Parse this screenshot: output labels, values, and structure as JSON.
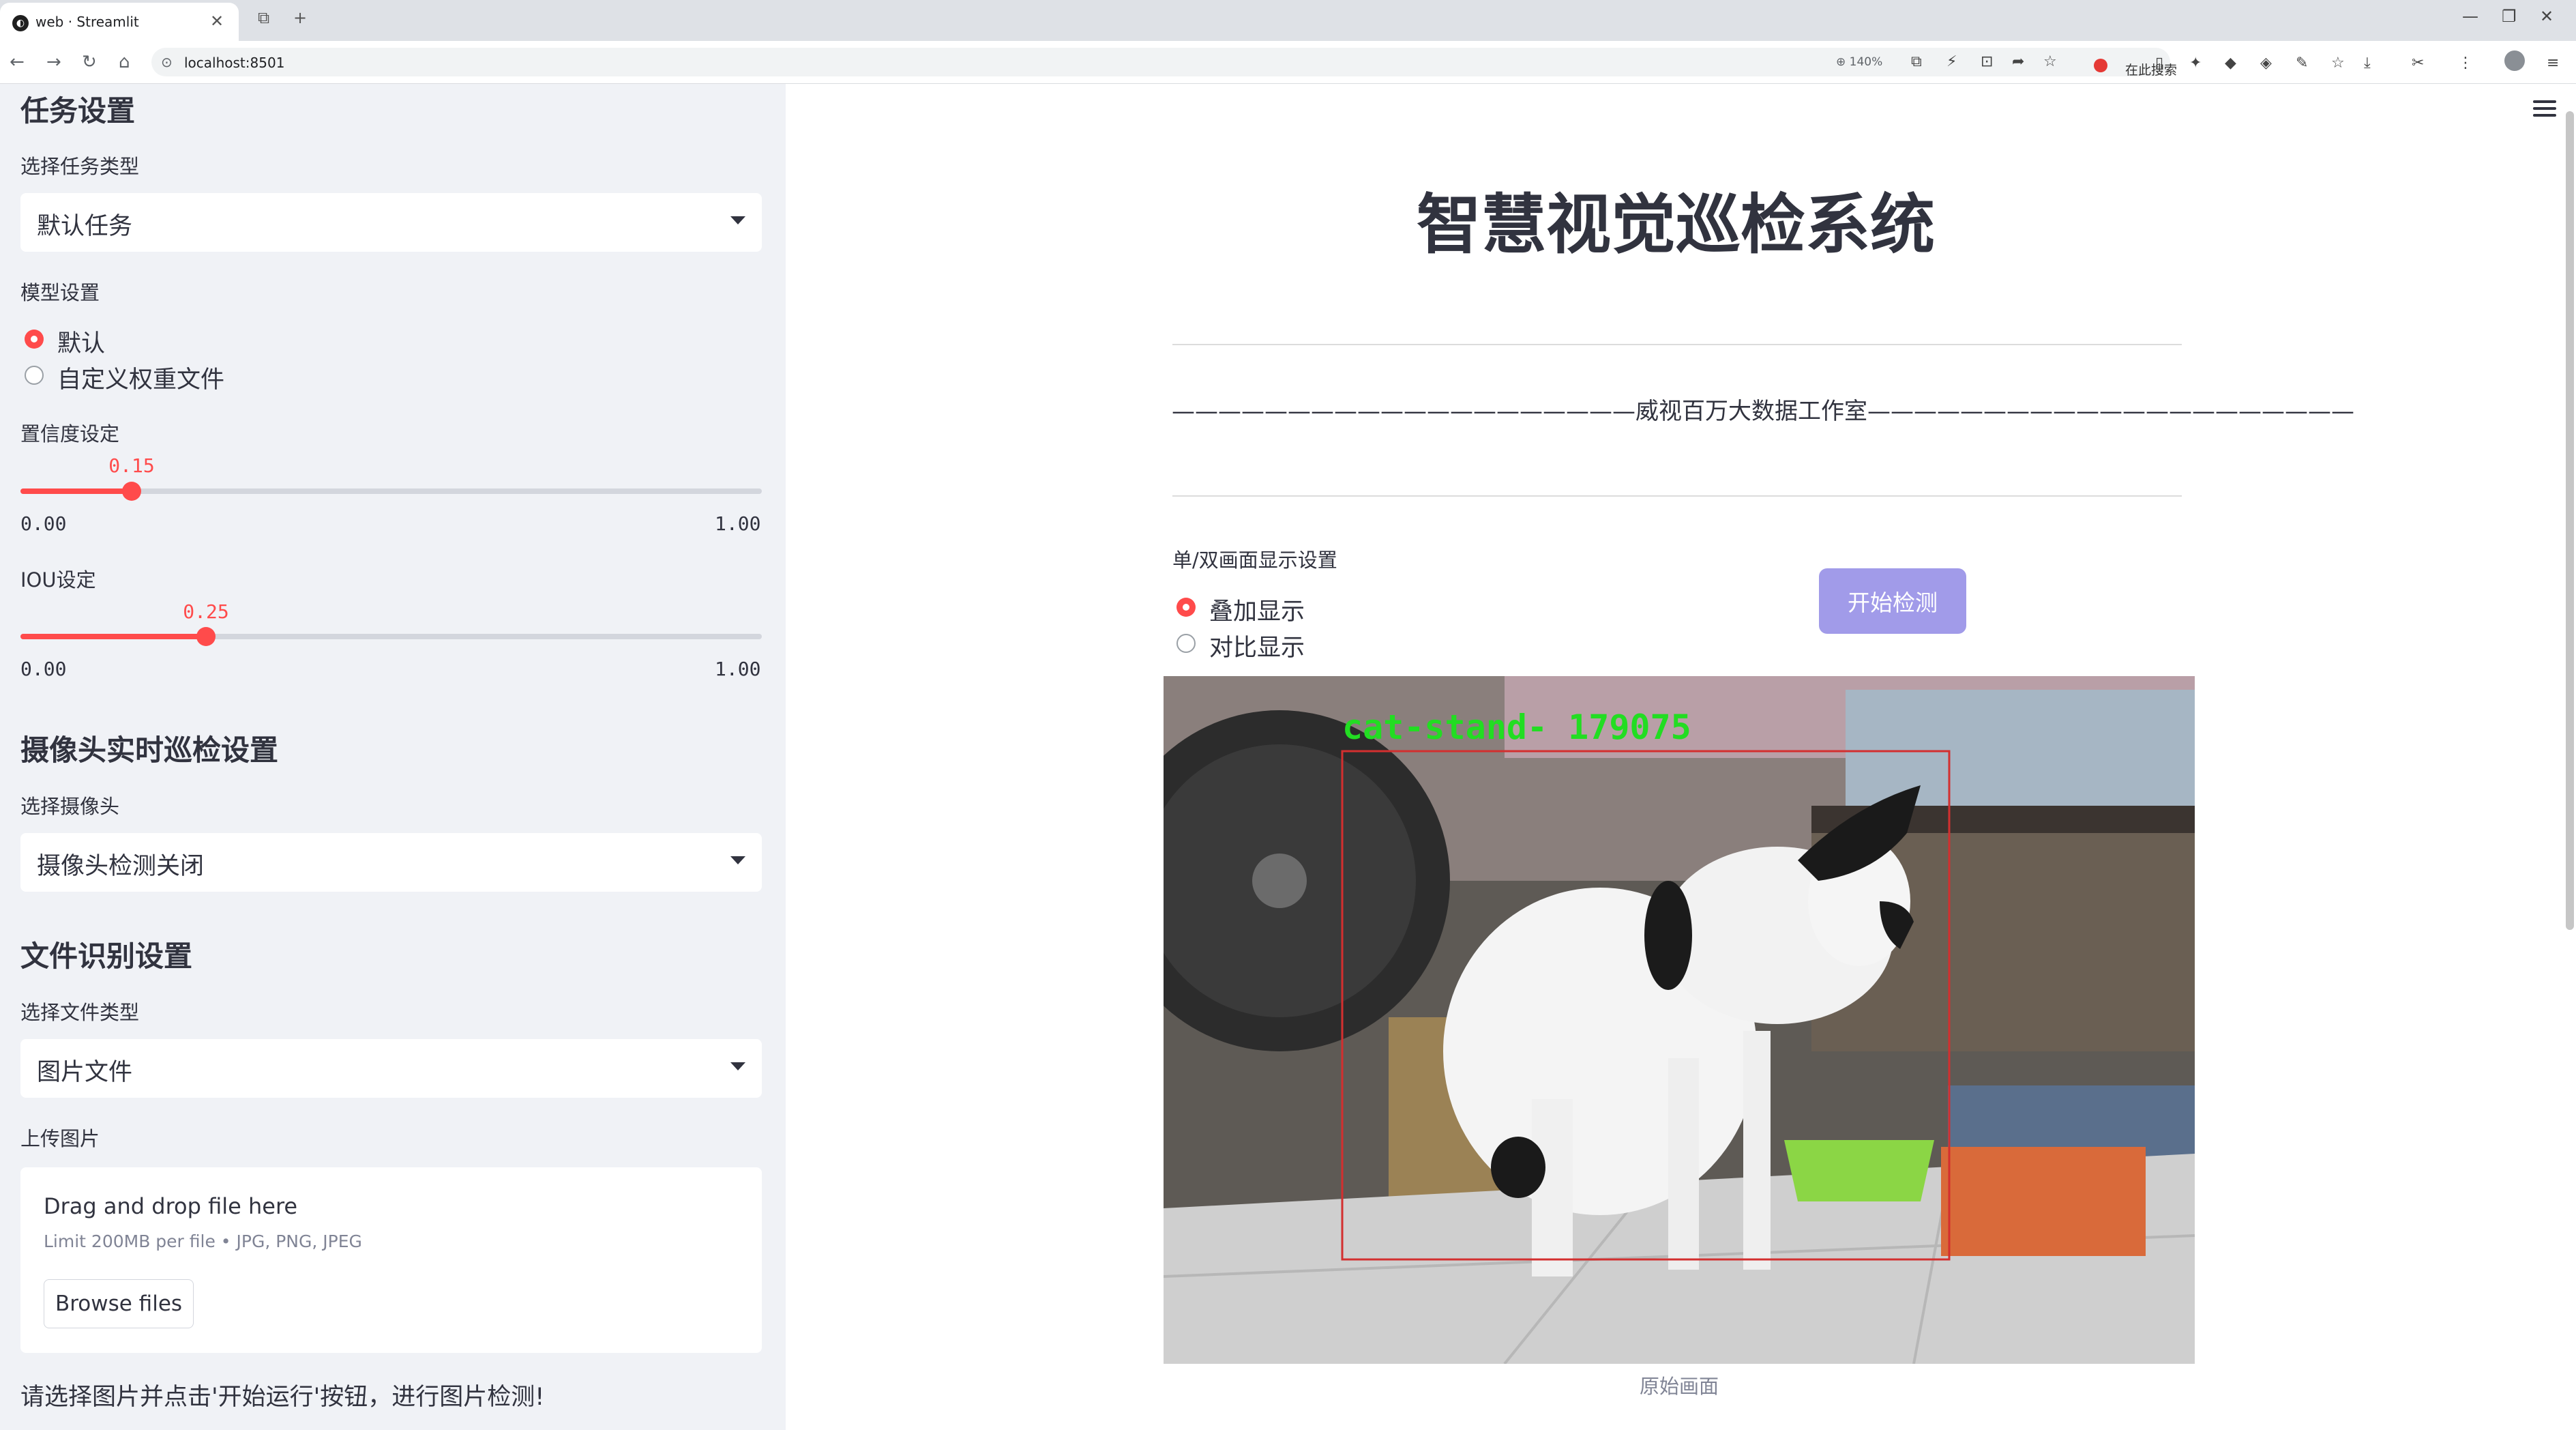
{
  "browser": {
    "tab_title": "web · Streamlit",
    "address": "localhost:8501",
    "zoom": "140%",
    "search_placeholder": "在此搜索"
  },
  "sidebar": {
    "task_section": {
      "heading": "任务设置",
      "select_label": "选择任务类型",
      "select_value": "默认任务"
    },
    "model_section": {
      "label": "模型设置",
      "options": [
        {
          "label": "默认",
          "selected": true
        },
        {
          "label": "自定义权重文件",
          "selected": false
        }
      ]
    },
    "confidence": {
      "label": "置信度设定",
      "value": 0.15,
      "value_text": "0.15",
      "min": "0.00",
      "max": "1.00"
    },
    "iou": {
      "label": "IOU设定",
      "value": 0.25,
      "value_text": "0.25",
      "min": "0.00",
      "max": "1.00"
    },
    "camera_section": {
      "heading": "摄像头实时巡检设置",
      "select_label": "选择摄像头",
      "select_value": "摄像头检测关闭"
    },
    "file_section": {
      "heading": "文件识别设置",
      "select_label": "选择文件类型",
      "select_value": "图片文件",
      "upload_label": "上传图片",
      "drop_title": "Drag and drop file here",
      "drop_limit": "Limit 200MB per file • JPG, PNG, JPEG",
      "browse_button": "Browse files"
    },
    "note": "请选择图片并点击'开始运行'按钮，进行图片检测!"
  },
  "main": {
    "title": "智慧视觉巡检系统",
    "banner": "————————————————————威视百万大数据工作室—————————————————————",
    "display_label": "单/双画面显示设置",
    "display_options": [
      {
        "label": "叠加显示",
        "selected": true
      },
      {
        "label": "对比显示",
        "selected": false
      }
    ],
    "start_button": "开始检测",
    "detection_label": "cat-stand- 179075",
    "image_caption": "原始画面"
  },
  "colors": {
    "accent": "#ff4b4b",
    "button": "#a19be9",
    "sidebar_bg": "#f0f2f6",
    "detection_box": "#d32f2f",
    "detection_text": "#22dd22"
  }
}
